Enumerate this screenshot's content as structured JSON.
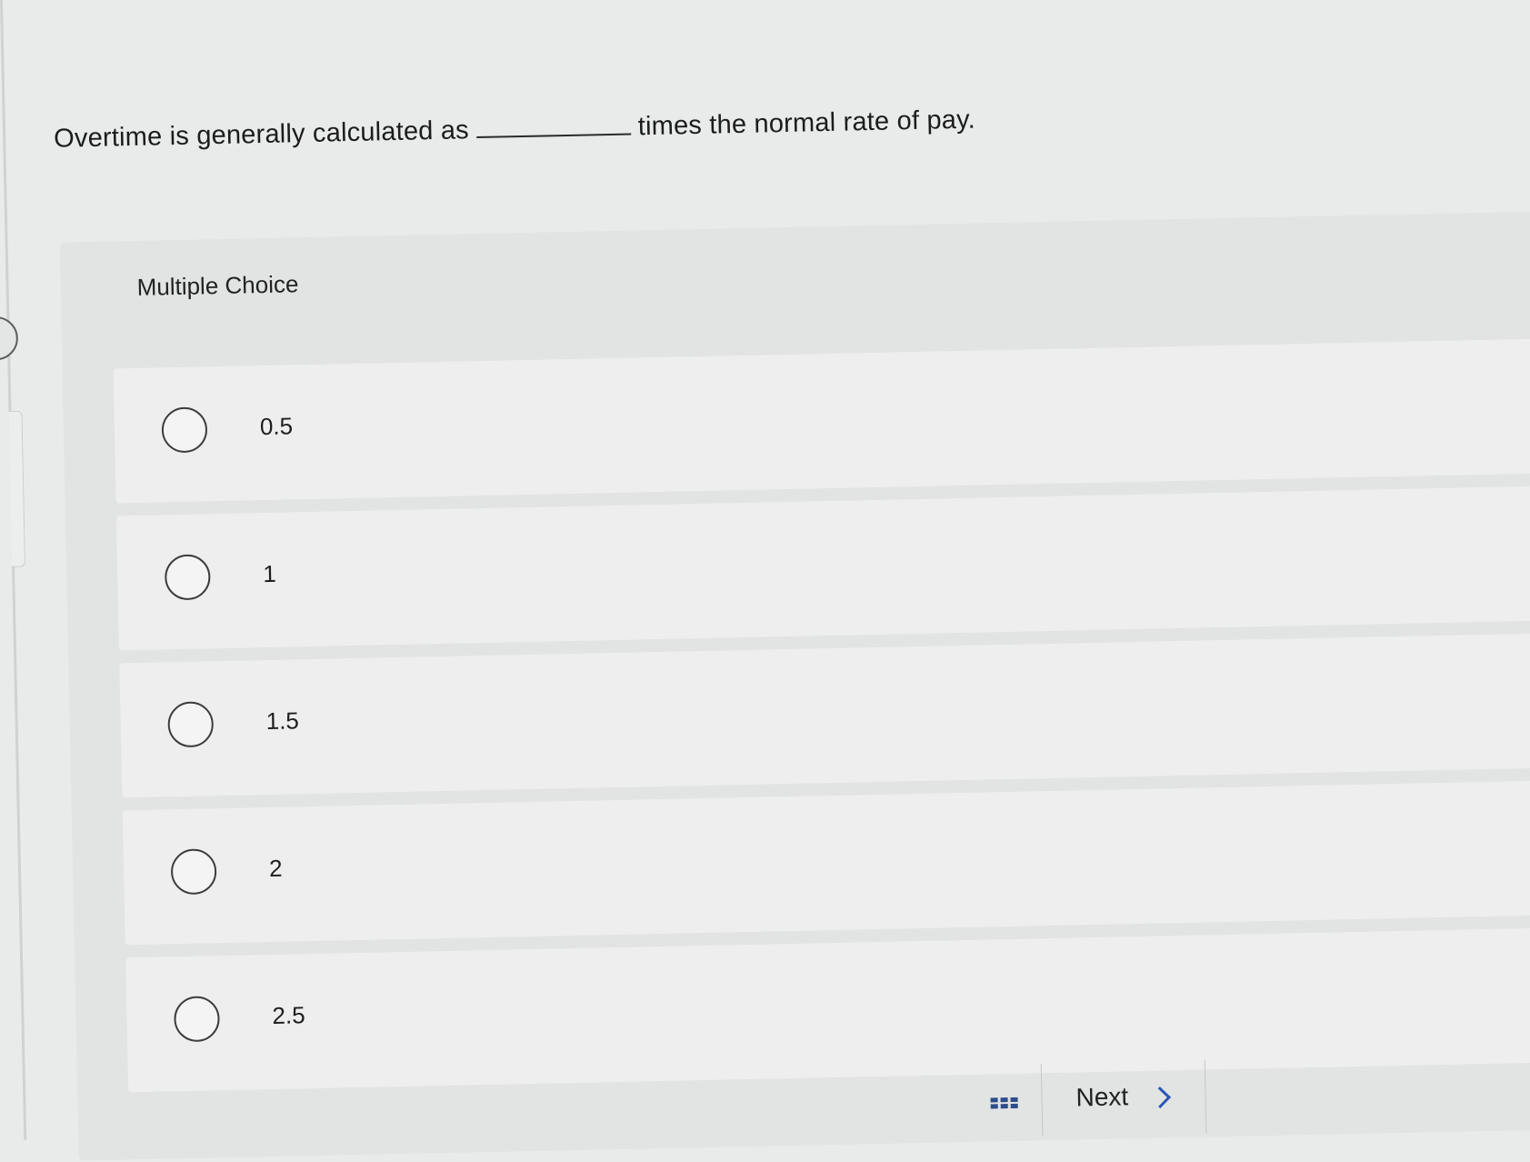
{
  "question": {
    "before_blank": "Overtime is generally calculated as",
    "after_blank": "times the normal rate of pay."
  },
  "section": {
    "label": "Multiple Choice"
  },
  "options": [
    {
      "label": "0.5"
    },
    {
      "label": "1"
    },
    {
      "label": "1.5"
    },
    {
      "label": "2"
    },
    {
      "label": "2.5"
    }
  ],
  "footer": {
    "next_label": "Next",
    "grid_icon": "grid-icon",
    "chevron_icon": "chevron-right-icon"
  }
}
